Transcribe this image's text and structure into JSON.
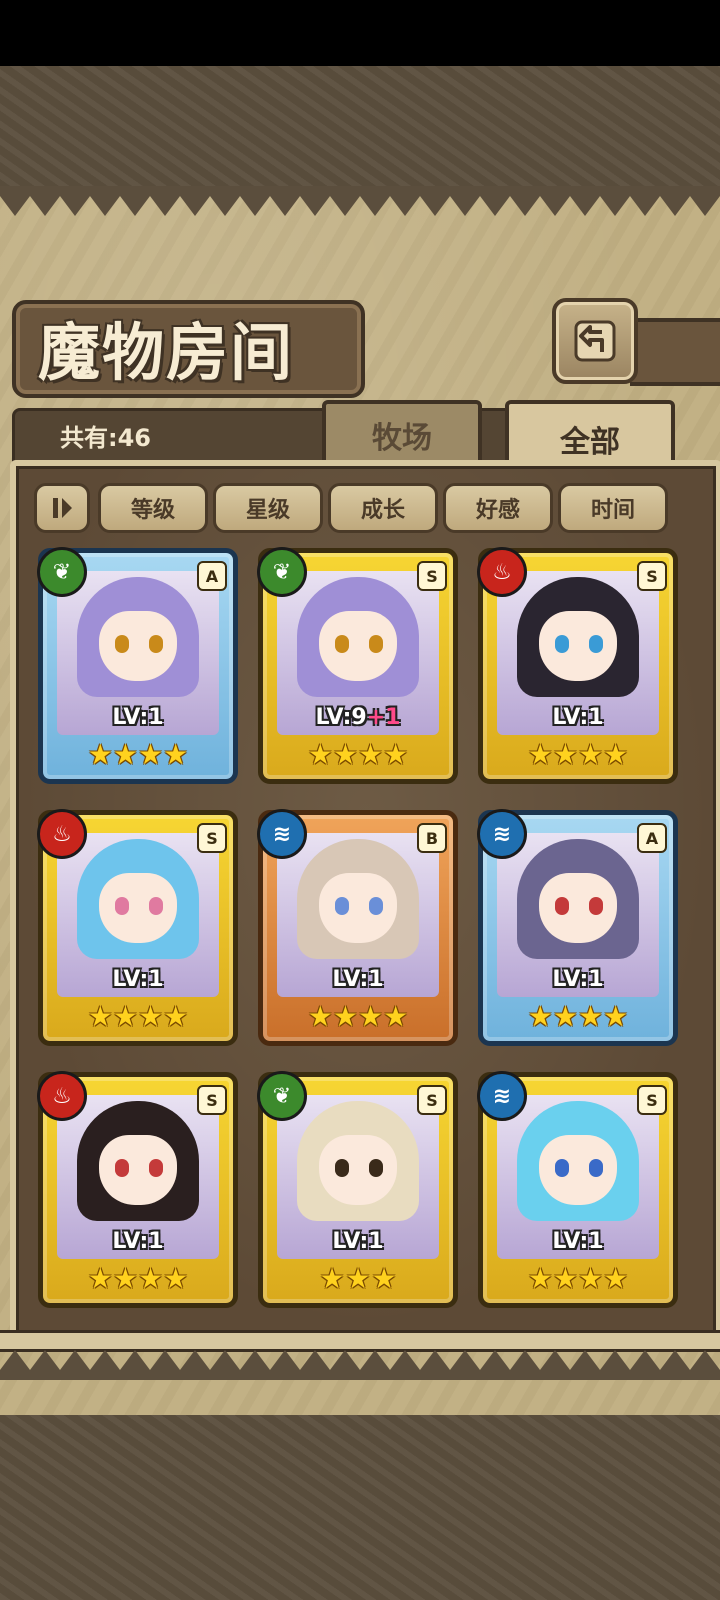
{
  "header": {
    "title": "魔物房间"
  },
  "count": {
    "label": "共有:46"
  },
  "tabs": [
    {
      "label": "牧场"
    },
    {
      "label": "全部"
    }
  ],
  "sort_buttons": [
    {
      "label": "等级"
    },
    {
      "label": "星级"
    },
    {
      "label": "成长"
    },
    {
      "label": "好感"
    },
    {
      "label": "时间"
    }
  ],
  "monsters": [
    {
      "element": "grass",
      "rank": "A",
      "level": "LV:1",
      "plus": "",
      "stars": 4,
      "frame": "blue"
    },
    {
      "element": "grass",
      "rank": "S",
      "level": "LV:9",
      "plus": "+1",
      "stars": 4,
      "frame": "gold"
    },
    {
      "element": "fire",
      "rank": "S",
      "level": "LV:1",
      "plus": "",
      "stars": 4,
      "frame": "gold"
    },
    {
      "element": "fire",
      "rank": "S",
      "level": "LV:1",
      "plus": "",
      "stars": 4,
      "frame": "gold"
    },
    {
      "element": "water",
      "rank": "B",
      "level": "LV:1",
      "plus": "",
      "stars": 4,
      "frame": "bronze"
    },
    {
      "element": "water",
      "rank": "A",
      "level": "LV:1",
      "plus": "",
      "stars": 4,
      "frame": "blue"
    },
    {
      "element": "fire",
      "rank": "S",
      "level": "LV:1",
      "plus": "",
      "stars": 4,
      "frame": "gold"
    },
    {
      "element": "grass",
      "rank": "S",
      "level": "LV:1",
      "plus": "",
      "stars": 3,
      "frame": "gold"
    },
    {
      "element": "water",
      "rank": "S",
      "level": "LV:1",
      "plus": "",
      "stars": 4,
      "frame": "gold"
    }
  ],
  "colors": {
    "grass": "#3c8a2c",
    "fire": "#c8251c",
    "water": "#1f6fb0",
    "gold_frame": "#f7d633",
    "blue_frame": "#a8d8f2",
    "bronze_frame": "#f0a45a",
    "panel": "#c2b185"
  }
}
